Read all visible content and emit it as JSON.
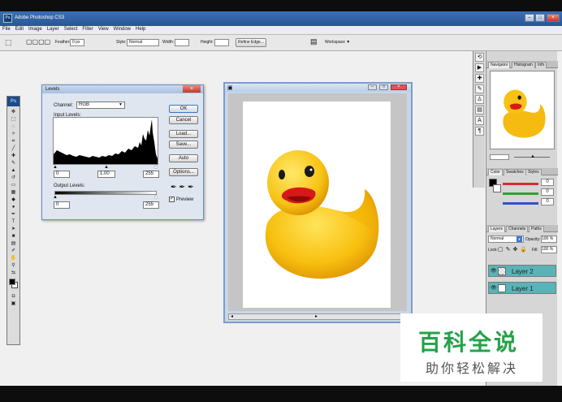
{
  "app": {
    "title": "Adobe Photoshop CS3",
    "badge": "Ps"
  },
  "menu": [
    "File",
    "Edit",
    "Image",
    "Layer",
    "Select",
    "Filter",
    "View",
    "Window",
    "Help"
  ],
  "options": {
    "feather_label": "Feather:",
    "feather_value": "0 px",
    "style_label": "Style:",
    "style_value": "Normal",
    "width_label": "Width:",
    "height_label": "Height:",
    "refine_edge": "Refine Edge...",
    "workspace": "Workspace ▼"
  },
  "levels": {
    "title": "Levels",
    "channel_label": "Channel:",
    "channel_value": "RGB",
    "input_levels_label": "Input Levels:",
    "input_black": "0",
    "input_gamma": "1.00",
    "input_white": "255",
    "output_levels_label": "Output Levels:",
    "output_black": "0",
    "output_white": "255",
    "ok": "OK",
    "cancel": "Cancel",
    "load": "Load...",
    "save": "Save...",
    "auto": "Auto",
    "options": "Options...",
    "preview": "Preview",
    "preview_checked": true
  },
  "navigator": {
    "tabs": [
      "Navigator",
      "Histogram",
      "Info"
    ]
  },
  "color_panel": {
    "tabs": [
      "Color",
      "Swatches",
      "Styles"
    ],
    "values": [
      "0",
      "0",
      "0"
    ],
    "colors": [
      "#d03030",
      "#30a030",
      "#3050d0"
    ]
  },
  "layers": {
    "tabs": [
      "Layers",
      "Channels",
      "Paths"
    ],
    "blend_mode": "Normal",
    "opacity_label": "Opacity:",
    "opacity_value": "100 %",
    "lock_label": "Lock:",
    "fill_label": "Fill:",
    "fill_value": "100 %",
    "items": [
      {
        "name": "Layer 2"
      },
      {
        "name": "Layer 1"
      }
    ],
    "selected_color": "#5ab3b8"
  },
  "watermark": {
    "title": "百科全说",
    "subtitle": "助你轻松解决"
  }
}
